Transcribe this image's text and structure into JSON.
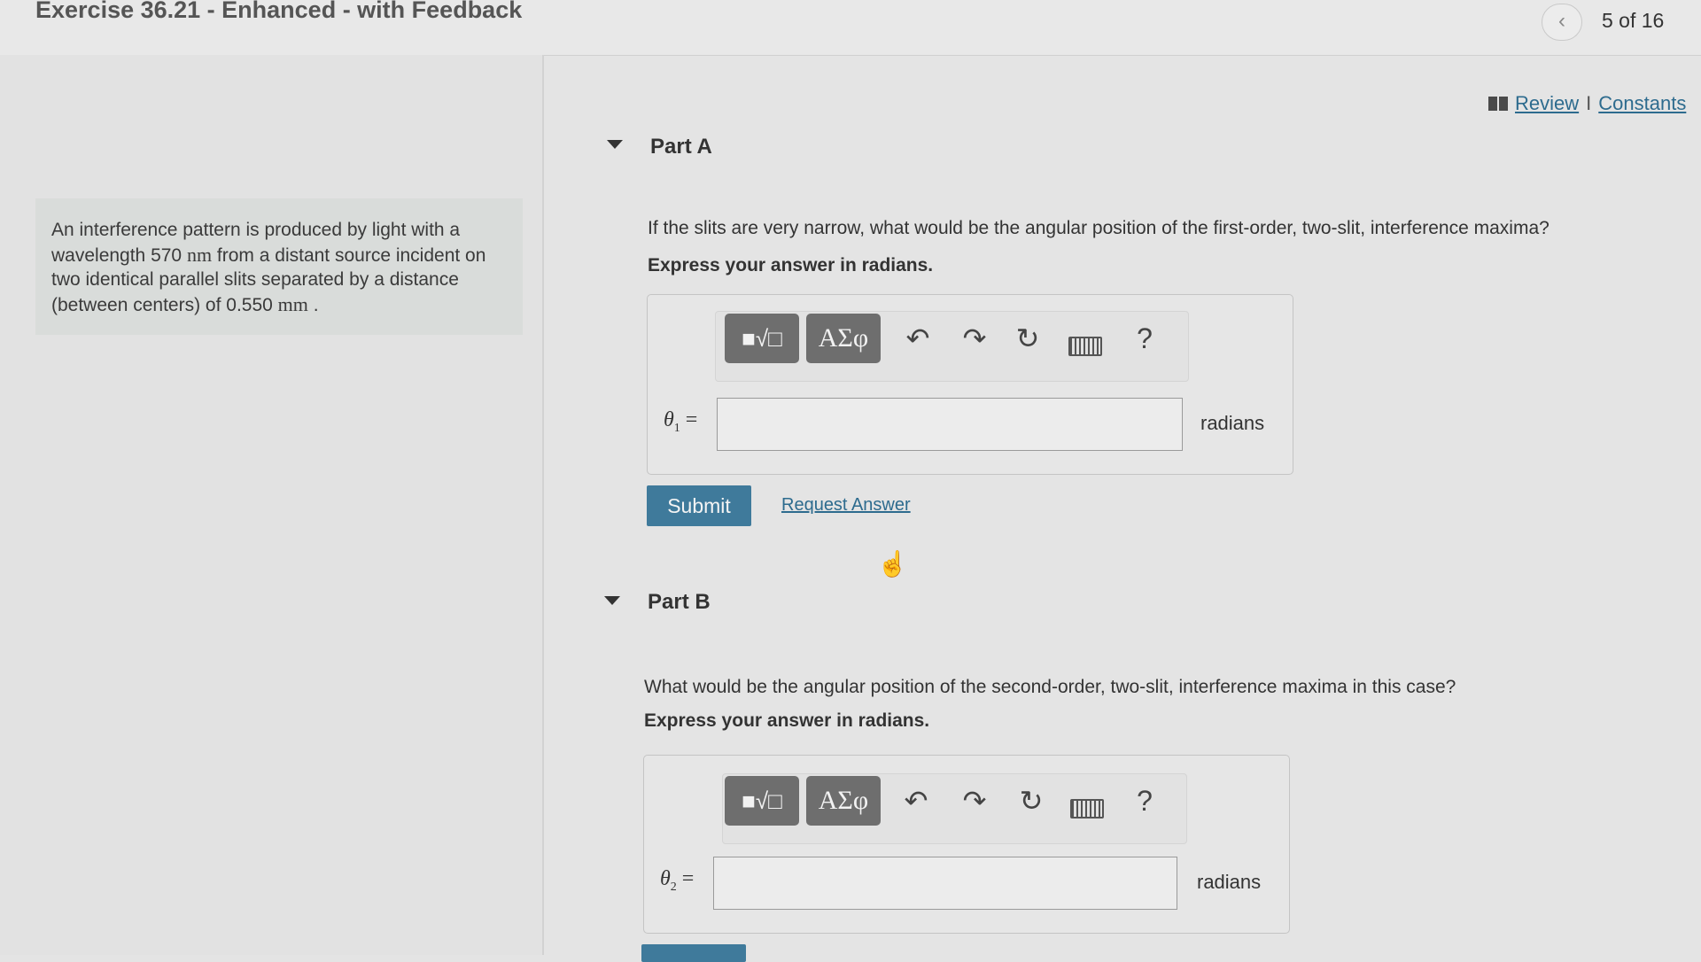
{
  "header": {
    "title": "Exercise 36.21 - Enhanced - with Feedback",
    "back_icon": "‹",
    "page_count": "5 of 16"
  },
  "intro": {
    "text_1": "An interference pattern is produced by light with a wavelength 570 ",
    "unit_nm": "nm",
    "text_2": " from a distant source incident on two identical parallel slits separated by a distance (between centers) of 0.550 ",
    "unit_mm": "mm",
    "text_3": " ."
  },
  "links": {
    "review": "Review",
    "separator": "I",
    "constants": "Constants"
  },
  "toolbar": {
    "templates_label": "■√□",
    "greek_label": "ΑΣφ",
    "undo_icon": "↶",
    "redo_icon": "↷",
    "reset_icon": "↻",
    "help_label": "?"
  },
  "part_a": {
    "title": "Part A",
    "question": "If the slits are very narrow, what would be the angular position of the first-order, two-slit, interference maxima?",
    "instruction": "Express your answer in radians.",
    "var_symbol": "θ",
    "var_subscript": "1",
    "equals": "=",
    "input_value": "",
    "unit": "radians",
    "submit": "Submit",
    "request_answer": "Request Answer"
  },
  "part_b": {
    "title": "Part B",
    "question": "What would be the angular position of the second-order, two-slit, interference maxima in this case?",
    "instruction": "Express your answer in radians.",
    "var_symbol": "θ",
    "var_subscript": "2",
    "equals": "=",
    "input_value": "",
    "unit": "radians"
  },
  "colors": {
    "accent": "#3f7a9b",
    "link": "#2d6b8e",
    "toolbar_button": "#6e6e6e"
  }
}
